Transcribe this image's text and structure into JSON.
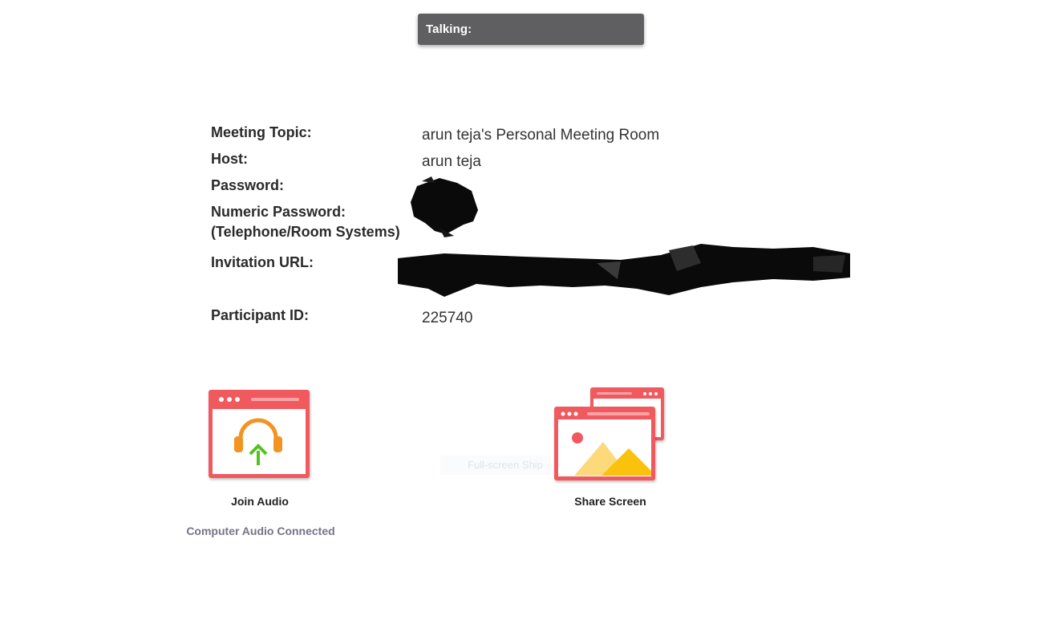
{
  "talking": {
    "label": "Talking:"
  },
  "meeting_info": {
    "topic_label": "Meeting Topic:",
    "topic_value": "arun teja's Personal Meeting Room",
    "host_label": "Host:",
    "host_value": "arun teja",
    "password_label": "Password:",
    "numeric_password_label_line1": "Numeric Password:",
    "numeric_password_label_line2": "(Telephone/Room Systems)",
    "invitation_url_label": "Invitation URL:",
    "participant_id_label": "Participant ID:",
    "participant_id_value": "225740"
  },
  "actions": {
    "join_audio_label": "Join Audio",
    "join_audio_status": "Computer Audio Connected",
    "share_screen_label": "Share Screen"
  },
  "overlay": {
    "ghost_tooltip": "Full-screen Ship"
  },
  "colors": {
    "talking_bg": "#5f5f61",
    "tile_red": "#f05a5f",
    "headphone_orange": "#f39322",
    "arrow_green": "#54c21f",
    "mountain_light": "#fcd97a",
    "mountain_dark": "#fbc20d",
    "status_gray": "#747487"
  },
  "icons": {
    "join_audio": "headphone-upload-icon",
    "share_screen": "share-screen-windows-icon"
  }
}
